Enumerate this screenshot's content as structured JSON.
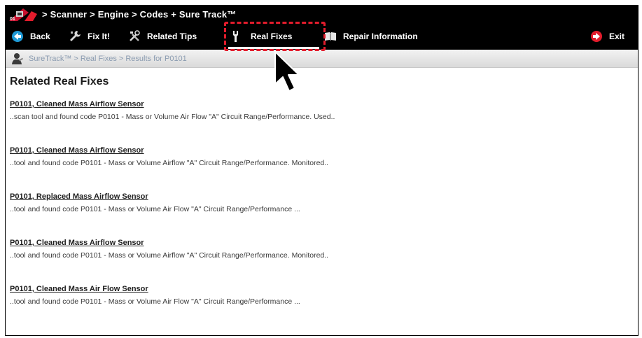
{
  "titlebar": {
    "crumb": "> Scanner  > Engine  > Codes + Sure Track™"
  },
  "toolbar": {
    "back": "Back",
    "fix_it": "Fix It!",
    "related_tips": "Related Tips",
    "real_fixes": "Real Fixes",
    "repair_information": "Repair Information",
    "exit": "Exit",
    "active_tab": "Real Fixes",
    "highlight_color": "#e31c2c"
  },
  "breadcrumb": {
    "text": "SureTrack™ > Real Fixes > Results for P0101"
  },
  "main": {
    "section_title": "Related Real Fixes",
    "fixes": [
      {
        "title": "P0101, Cleaned Mass Airflow Sensor",
        "snippet": "..scan tool and found code P0101 - Mass or Volume Air Flow \"A\" Circuit Range/Performance. Used.."
      },
      {
        "title": "P0101, Cleaned Mass Airflow Sensor",
        "snippet": "..tool and found code P0101 - Mass or Volume Airflow \"A\" Circuit Range/Performance. Monitored.."
      },
      {
        "title": "P0101, Replaced Mass Airflow Sensor",
        "snippet": "..tool and found code P0101 - Mass or Volume Air Flow \"A\" Circuit Range/Performance ..."
      },
      {
        "title": "P0101, Cleaned Mass Airflow Sensor",
        "snippet": "..tool and found code P0101 - Mass or Volume Airflow \"A\" Circuit Range/Performance. Monitored.."
      },
      {
        "title": "P0101, Cleaned Mass Air Flow Sensor",
        "snippet": "..tool and found code P0101 - Mass or Volume Air Flow \"A\" Circuit Range/Performance ..."
      }
    ]
  }
}
